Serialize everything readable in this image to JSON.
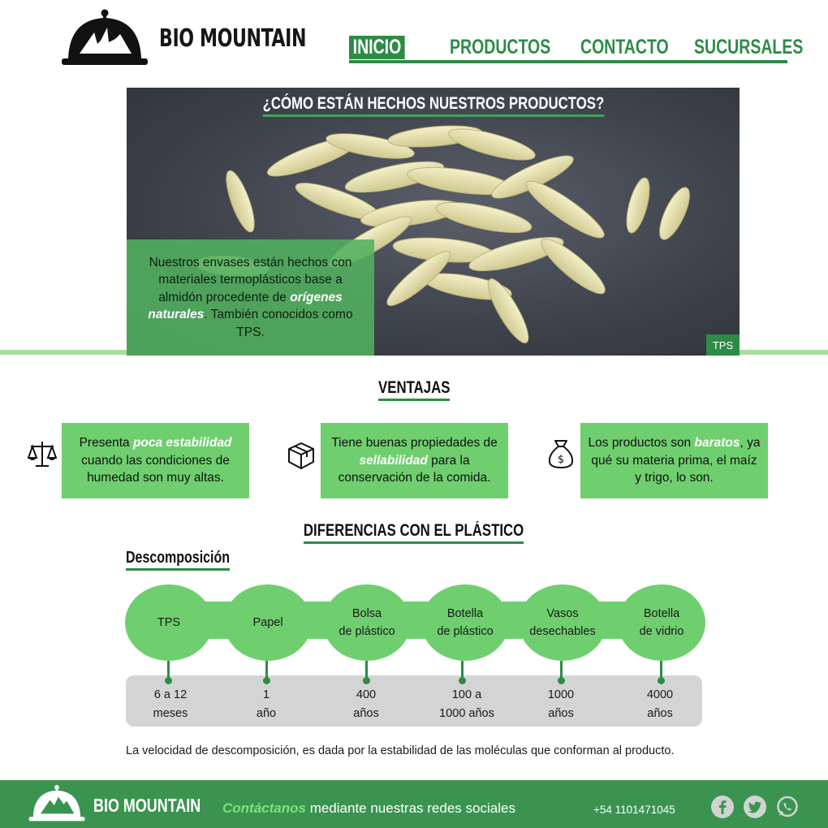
{
  "header": {
    "brand": "BIO MOUNTAIN",
    "nav": [
      "INICIO",
      "PRODUCTOS",
      "CONTACTO",
      "SUCURSALES"
    ],
    "active_nav": "INICIO"
  },
  "hero": {
    "title": "¿CÓMO ESTÁN HECHOS NUESTROS PRODUCTOS?",
    "text_1": "Nuestros envases están hechos con materiales termoplásticos base a almidón procedente de",
    "text_highlight": "orígenes naturales",
    "text_2": ". También conocidos como TPS.",
    "tag": "TPS"
  },
  "ventajas": {
    "title": "VENTAJAS",
    "items": [
      {
        "icon": "scale-icon",
        "pre": "Presenta ",
        "highlight": "poca estabilidad",
        "post": " cuando las condiciones de humedad son muy altas."
      },
      {
        "icon": "box-icon",
        "pre": "Tiene buenas propiedades de ",
        "highlight": "sellabilidad",
        "post": " para la conservación de la comida."
      },
      {
        "icon": "money-bag-icon",
        "pre": "Los productos son ",
        "highlight": "baratos",
        "post": ", ya qué su materia prima, el maíz y trigo, lo son."
      }
    ]
  },
  "diferencias": {
    "title": "DIFERENCIAS CON EL PLÁSTICO",
    "subtitle": "Descomposición",
    "items": [
      {
        "name_1": "TPS",
        "name_2": "",
        "time_1": "6 a 12",
        "time_2": "meses"
      },
      {
        "name_1": "Papel",
        "name_2": "",
        "time_1": "1",
        "time_2": "año"
      },
      {
        "name_1": "Bolsa",
        "name_2": "de plástico",
        "time_1": "400",
        "time_2": "años"
      },
      {
        "name_1": "Botella",
        "name_2": "de plástico",
        "time_1": "100 a",
        "time_2": "1000 años"
      },
      {
        "name_1": "Vasos",
        "name_2": "desechables",
        "time_1": "1000",
        "time_2": "años"
      },
      {
        "name_1": "Botella",
        "name_2": "de vidrio",
        "time_1": "4000",
        "time_2": "años"
      }
    ],
    "note": "La velocidad de descomposición, es dada por la estabilidad de las moléculas que conforman al producto."
  },
  "footer": {
    "brand": "BIO MOUNTAIN",
    "contact_highlight": "Contáctanos",
    "contact_text": " mediante nuestras redes sociales",
    "phone": "+54 1101471045",
    "social": [
      "facebook-icon",
      "twitter-icon",
      "whatsapp-icon"
    ]
  },
  "colors": {
    "primary_green": "#2e8b46",
    "light_green": "#6fcf6f",
    "footer_green": "#3a9450",
    "timeline_gray": "#d4d4d4"
  }
}
